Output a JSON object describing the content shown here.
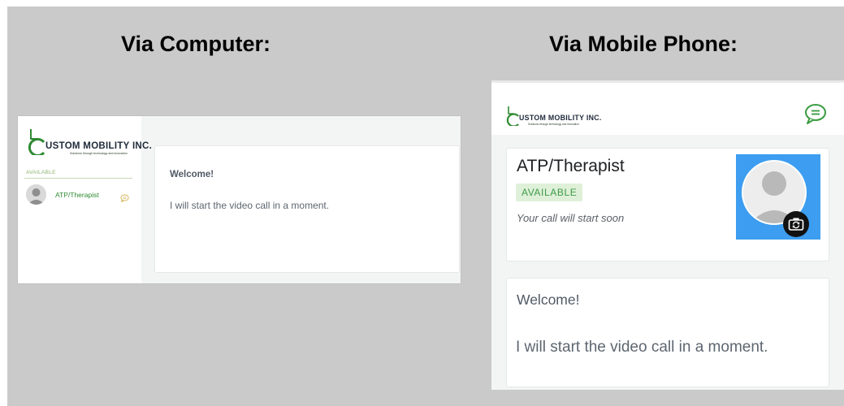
{
  "titles": {
    "computer": "Via Computer:",
    "mobile": "Via Mobile Phone:"
  },
  "brand": {
    "name": "USTOM MOBILITY INC.",
    "tagline": "Solutions through technology and innovation",
    "color": "#2f8a32"
  },
  "desktop": {
    "available_label": "AVAILABLE",
    "participant_name": "ATP/Therapist",
    "welcome": "Welcome!",
    "message": "I will start the video call in a moment."
  },
  "mobile": {
    "participant_name": "ATP/Therapist",
    "status_badge": "AVAILABLE",
    "status_subtext": "Your call will start soon",
    "welcome": "Welcome!",
    "message": "I will start the video call in a moment."
  },
  "icons": {
    "chat": "chat-bubble-icon",
    "camera_switch": "camera-switch-icon",
    "avatar": "user-avatar-icon"
  },
  "colors": {
    "background": "#cacaca",
    "accent_green": "#2f8a32",
    "badge_bg": "#dff0d8",
    "video_bg": "#3d9df0"
  }
}
